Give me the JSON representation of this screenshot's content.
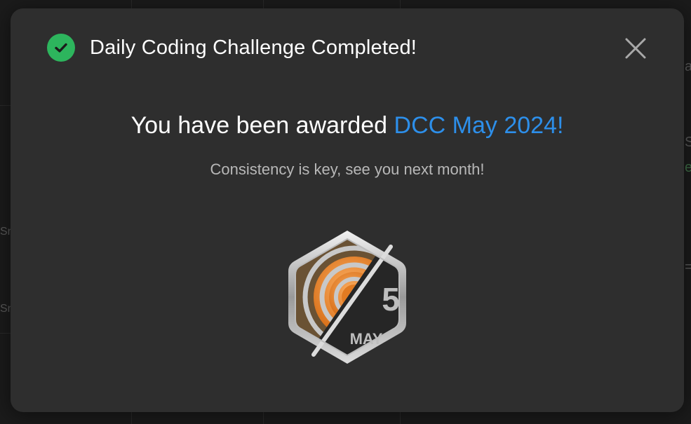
{
  "background": {
    "fragments": [
      "a",
      "S",
      "e",
      "Sn",
      "Sn",
      "="
    ]
  },
  "modal": {
    "title": "Daily Coding Challenge Completed!",
    "award_prefix": "You have been awarded ",
    "award_name": "DCC May 2024!",
    "subtitle": "Consistency is key, see you next month!",
    "badge": {
      "day": "5",
      "month": "MAY"
    }
  },
  "colors": {
    "success": "#2db55d",
    "link": "#2d8fea",
    "modal_bg": "#2e2e2e",
    "badge_orange": "#f08a2c"
  },
  "icons": {
    "header": "check-circle-icon",
    "close": "close-icon"
  }
}
